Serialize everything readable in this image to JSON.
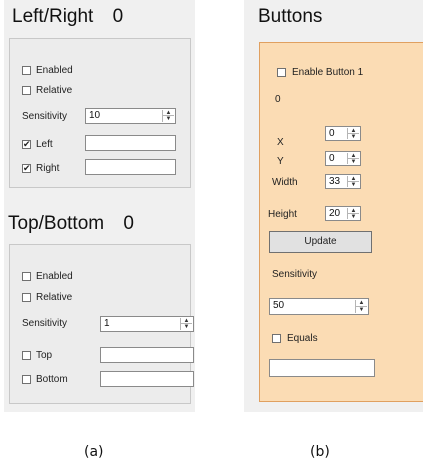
{
  "left_panel": {
    "lr": {
      "title": "Left/Right",
      "value": "0",
      "enabled_label": "Enabled",
      "relative_label": "Relative",
      "sensitivity_label": "Sensitivity",
      "sensitivity_value": "10",
      "left_label": "Left",
      "right_label": "Right",
      "left_checked_mark": "✔",
      "right_checked_mark": "✔"
    },
    "tb": {
      "title": "Top/Bottom",
      "value": "0",
      "enabled_label": "Enabled",
      "relative_label": "Relative",
      "sensitivity_label": "Sensitivity",
      "sensitivity_value": "1",
      "top_label": "Top",
      "bottom_label": "Bottom"
    },
    "caption": "(a)"
  },
  "right_panel": {
    "title": "Buttons",
    "enable_label": "Enable Button 1",
    "value_text": "0",
    "x_label": "X",
    "x_value": "0",
    "y_label": "Y",
    "y_value": "0",
    "width_label": "Width",
    "width_value": "33",
    "height_label": "Height",
    "height_value": "20",
    "update_label": "Update",
    "sensitivity_label": "Sensitivity",
    "sensitivity_value": "50",
    "equals_label": "Equals",
    "caption": "(b)",
    "accent_color": "#fbdcb4",
    "border_color": "#e0a060"
  },
  "spinner_arrows": {
    "up": "▲",
    "down": "▼"
  }
}
